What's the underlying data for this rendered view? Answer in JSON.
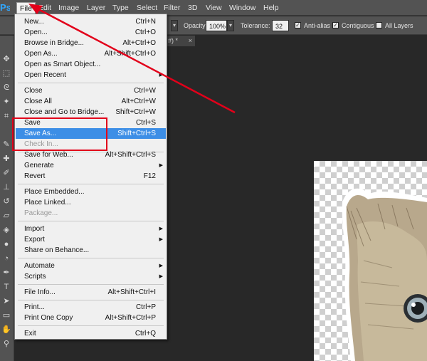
{
  "app": {
    "logo": "Ps"
  },
  "menubar": {
    "items": [
      {
        "label": "File",
        "active": true
      },
      {
        "label": "Edit"
      },
      {
        "label": "Image"
      },
      {
        "label": "Layer"
      },
      {
        "label": "Type"
      },
      {
        "label": "Select"
      },
      {
        "label": "Filter"
      },
      {
        "label": "3D"
      },
      {
        "label": "View"
      },
      {
        "label": "Window"
      },
      {
        "label": "Help"
      }
    ]
  },
  "options": {
    "opacity_label": "Opacity:",
    "opacity_value": "100%",
    "tolerance_label": "Tolerance:",
    "tolerance_value": "32",
    "antialias_label": "Anti-alias",
    "contiguous_label": "Contiguous",
    "all_layers_label": "All Layers",
    "antialias_checked": true,
    "contiguous_checked": true,
    "all_layers_checked": false
  },
  "document_tab": {
    "title": "#) *",
    "close": "×"
  },
  "file_menu": {
    "items": [
      {
        "label": "New...",
        "shortcut": "Ctrl+N"
      },
      {
        "label": "Open...",
        "shortcut": "Ctrl+O"
      },
      {
        "label": "Browse in Bridge...",
        "shortcut": "Alt+Ctrl+O"
      },
      {
        "label": "Open As...",
        "shortcut": "Alt+Shift+Ctrl+O"
      },
      {
        "label": "Open as Smart Object..."
      },
      {
        "label": "Open Recent",
        "submenu": true
      },
      {
        "label": "Close",
        "shortcut": "Ctrl+W"
      },
      {
        "label": "Close All",
        "shortcut": "Alt+Ctrl+W"
      },
      {
        "label": "Close and Go to Bridge...",
        "shortcut": "Shift+Ctrl+W"
      },
      {
        "label": "Save",
        "shortcut": "Ctrl+S"
      },
      {
        "label": "Save As...",
        "shortcut": "Shift+Ctrl+S",
        "highlighted": true
      },
      {
        "label": "Check In...",
        "disabled": true
      },
      {
        "label": "Save for Web...",
        "shortcut": "Alt+Shift+Ctrl+S"
      },
      {
        "label": "Generate",
        "submenu": true
      },
      {
        "label": "Revert",
        "shortcut": "F12"
      },
      {
        "label": "Place Embedded..."
      },
      {
        "label": "Place Linked..."
      },
      {
        "label": "Package...",
        "disabled": true
      },
      {
        "label": "Import",
        "submenu": true
      },
      {
        "label": "Export",
        "submenu": true
      },
      {
        "label": "Share on Behance..."
      },
      {
        "label": "Automate",
        "submenu": true
      },
      {
        "label": "Scripts",
        "submenu": true
      },
      {
        "label": "File Info...",
        "shortcut": "Alt+Shift+Ctrl+I"
      },
      {
        "label": "Print...",
        "shortcut": "Ctrl+P"
      },
      {
        "label": "Print One Copy",
        "shortcut": "Alt+Shift+Ctrl+P"
      },
      {
        "label": "Exit",
        "shortcut": "Ctrl+Q"
      }
    ]
  },
  "icons": {
    "submenu_arrow": "▶",
    "check": "✓",
    "dropdown": "▾"
  },
  "colors": {
    "highlight": "#3d8ee6",
    "annotation": "#e2001a",
    "menu_bg": "#f0f0f0",
    "chrome": "#535353",
    "workspace": "#282828"
  }
}
